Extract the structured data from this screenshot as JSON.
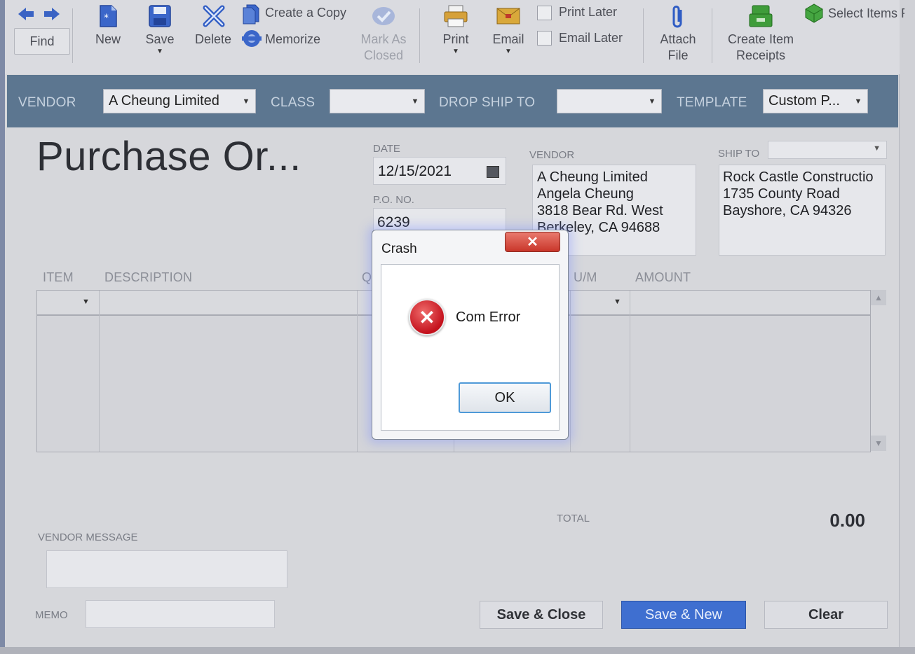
{
  "toolbar": {
    "find": "Find",
    "new": "New",
    "save": "Save",
    "delete": "Delete",
    "create_copy": "Create a Copy",
    "memorize": "Memorize",
    "mark_as": "Mark As",
    "closed": "Closed",
    "print": "Print",
    "email": "Email",
    "print_later": "Print Later",
    "email_later": "Email Later",
    "attach": "Attach",
    "file": "File",
    "create_item": "Create Item",
    "receipts": "Receipts",
    "select_items": "Select Items Re"
  },
  "header": {
    "vendor_label": "VENDOR",
    "vendor_value": "A Cheung Limited",
    "class_label": "CLASS",
    "class_value": "",
    "dropship_label": "DROP SHIP TO",
    "dropship_value": "",
    "template_label": "TEMPLATE",
    "template_value": "Custom P..."
  },
  "form": {
    "title": "Purchase Or...",
    "date_label": "DATE",
    "date_value": "12/15/2021",
    "po_label": "P.O. NO.",
    "po_value": "6239",
    "vendor_label": "VENDOR",
    "vendor_address": [
      "A Cheung Limited",
      "Angela Cheung",
      "3818 Bear Rd. West",
      "Berkeley, CA 94688"
    ],
    "shipto_label": "SHIP TO",
    "shipto_address": [
      "Rock Castle Constructio",
      "1735 County Road",
      "Bayshore, CA 94326"
    ]
  },
  "grid": {
    "columns": [
      "ITEM",
      "DESCRIPTION",
      "Q",
      "U/M",
      "AMOUNT"
    ]
  },
  "footer": {
    "total_label": "TOTAL",
    "total_value": "0.00",
    "vendor_message_label": "VENDOR MESSAGE",
    "memo_label": "MEMO",
    "save_close": "Save & Close",
    "save_new": "Save & New",
    "clear": "Clear"
  },
  "dialog": {
    "title": "Crash",
    "close_glyph": "✕",
    "message": "Com Error",
    "ok": "OK"
  }
}
